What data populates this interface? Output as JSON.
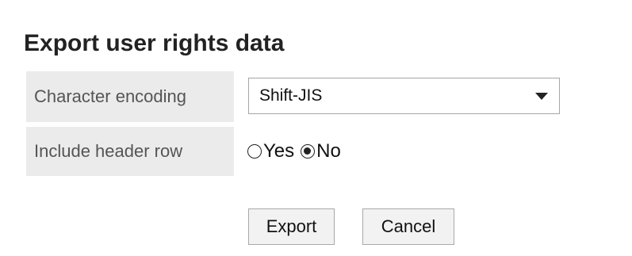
{
  "page": {
    "title": "Export user rights data"
  },
  "form": {
    "encoding": {
      "label": "Character encoding",
      "selected": "Shift-JIS"
    },
    "header_row": {
      "label": "Include header row",
      "options": [
        {
          "label": "Yes",
          "checked": false
        },
        {
          "label": "No",
          "checked": true
        }
      ]
    }
  },
  "actions": {
    "export_label": "Export",
    "cancel_label": "Cancel"
  },
  "icons": {
    "select_arrow": "chevron-down-icon",
    "radio_unchecked": "radio-unchecked-icon",
    "radio_checked": "radio-checked-icon"
  }
}
